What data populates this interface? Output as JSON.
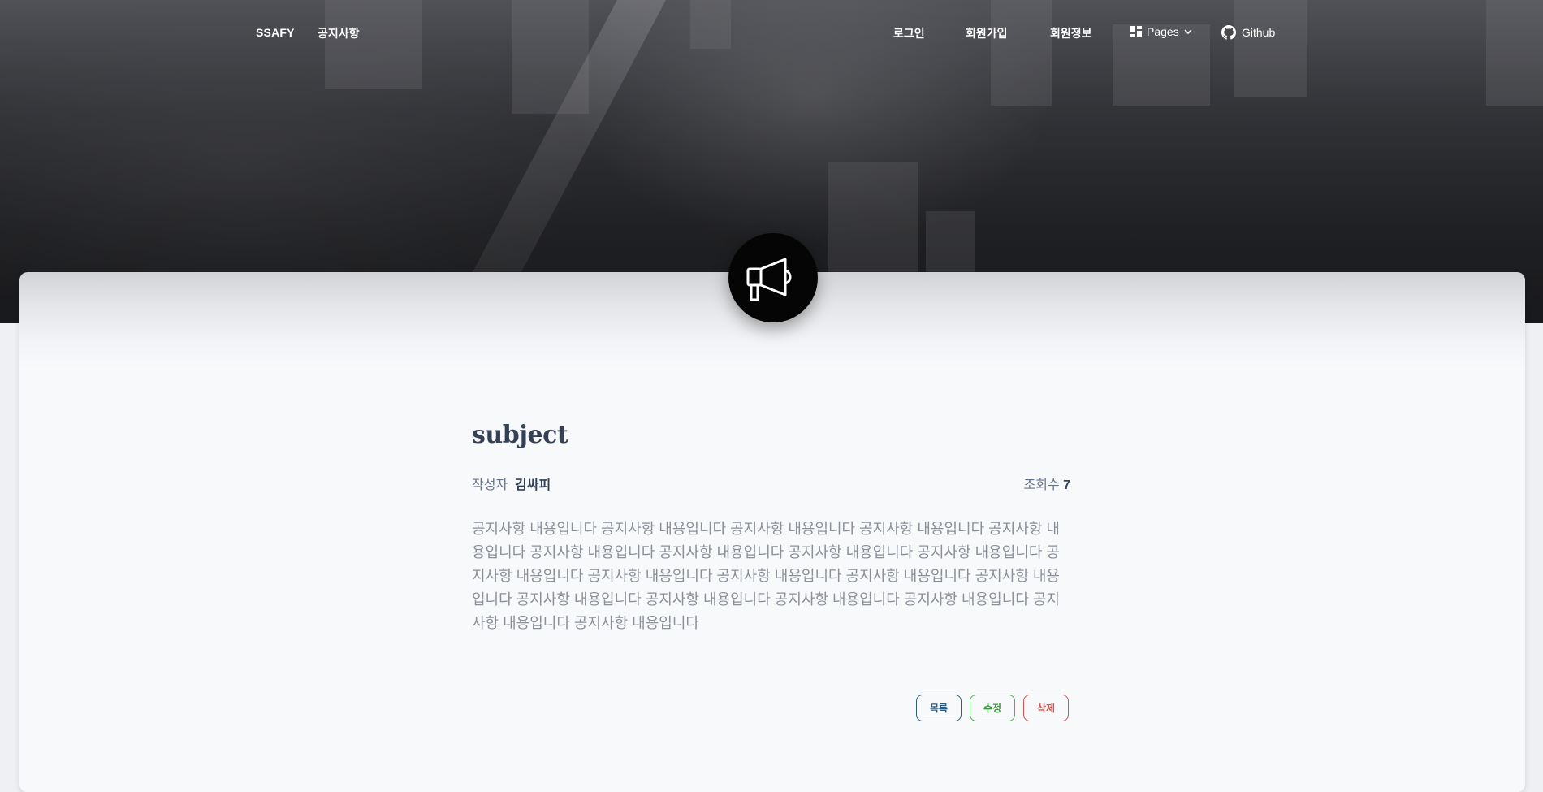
{
  "navbar": {
    "brand": "SSAFY",
    "notice": "공지사항",
    "login": "로그인",
    "join": "회원가입",
    "member_info": "회원정보",
    "pages": "Pages",
    "github": "Github"
  },
  "icons": {
    "hero_icon": "megaphone-icon",
    "pages_icon": "dashboard-grid-icon",
    "pages_caret": "chevron-down-icon",
    "github_icon": "github-icon"
  },
  "post": {
    "subject": "subject",
    "author_label": "작성자",
    "author_name": "김싸피",
    "views_label": "조회수",
    "views_count": "7",
    "content": "공지사항 내용입니다 공지사항 내용입니다 공지사항 내용입니다 공지사항 내용입니다 공지사항 내용입니다 공지사항 내용입니다 공지사항 내용입니다 공지사항 내용입니다 공지사항 내용입니다 공지사항 내용입니다 공지사항 내용입니다 공지사항 내용입니다 공지사항 내용입니다 공지사항 내용입니다 공지사항 내용입니다 공지사항 내용입니다 공지사항 내용입니다 공지사항 내용입니다 공지사항 내용입니다 공지사항 내용입니다"
  },
  "actions": {
    "list": "목록",
    "edit": "수정",
    "delete": "삭제"
  },
  "colors": {
    "heading": "#344055",
    "text_muted": "#8a8f98",
    "list_border": "#2f5f80",
    "edit_border": "#4caf50",
    "delete_border": "#d9534f"
  }
}
